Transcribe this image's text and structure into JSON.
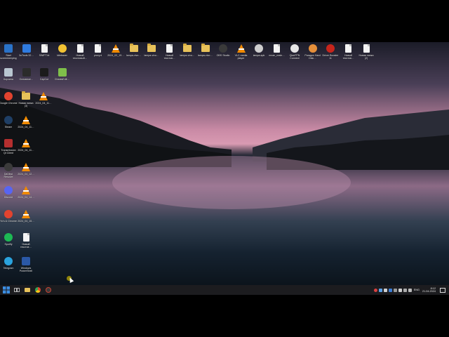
{
  "desktop": {
    "top_row": [
      {
        "label": "Start screenkeeping",
        "icon": "computer-icon",
        "kind": "square",
        "color": "#2a73c9"
      },
      {
        "label": "3uTools 32…",
        "icon": "3utools-icon",
        "kind": "square",
        "color": "#2f7be0"
      },
      {
        "label": "SWIFT.bt",
        "icon": "text-file-icon",
        "kind": "doc"
      },
      {
        "label": "Idlebacer",
        "icon": "emoji-icon",
        "kind": "circle",
        "color": "#f2c233"
      },
      {
        "label": "Новый текстовый…",
        "icon": "text-file-icon",
        "kind": "doc"
      },
      {
        "label": "proxy.d",
        "icon": "text-file-icon",
        "kind": "doc"
      },
      {
        "label": "2024_02_19…",
        "icon": "vlc-icon",
        "kind": "vlc"
      },
      {
        "label": "lampa-vivo…",
        "icon": "archive-icon",
        "kind": "folder"
      },
      {
        "label": "lampa-vivo…",
        "icon": "archive-icon",
        "kind": "folder"
      },
      {
        "label": "Новый текстов…",
        "icon": "text-file-icon",
        "kind": "doc"
      },
      {
        "label": "lampa-vivo…",
        "icon": "archive-icon",
        "kind": "folder"
      },
      {
        "label": "lampa-vivo…",
        "icon": "archive-icon",
        "kind": "folder"
      },
      {
        "label": "OBS Studio",
        "icon": "obs-icon",
        "kind": "circle",
        "color": "#3a3a3a"
      },
      {
        "label": "VLC media player",
        "icon": "vlc-icon",
        "kind": "vlc"
      },
      {
        "label": "lampa.apk",
        "icon": "apk-icon",
        "kind": "circle",
        "color": "#cfcfcf"
      },
      {
        "label": "mnan_reale…",
        "icon": "text-file-icon",
        "kind": "doc"
      },
      {
        "label": "QianFPN Connect",
        "icon": "vpn-icon",
        "kind": "circle",
        "color": "#e7e7e7"
      },
      {
        "label": "Paragon Hard Disk…",
        "icon": "paragon-icon",
        "kind": "circle",
        "color": "#e58f3a"
      },
      {
        "label": "Driver Booster 11",
        "icon": "driver-booster-icon",
        "kind": "circle",
        "color": "#c7251b"
      },
      {
        "label": "Новый текстов…",
        "icon": "text-file-icon",
        "kind": "doc"
      },
      {
        "label": "Новая папка (2)",
        "icon": "text-file-icon",
        "kind": "doc"
      }
    ],
    "second_row": [
      {
        "label": "Корзина",
        "icon": "recycle-bin-icon",
        "kind": "square",
        "color": "#b9c6d1"
      },
      {
        "label": "Основное…",
        "icon": "shortcut-icon",
        "kind": "square",
        "color": "#2b2b2b"
      },
      {
        "label": "CapCut",
        "icon": "capcut-icon",
        "kind": "square",
        "color": "#1b1b1b"
      },
      {
        "label": "CheatsEdit…",
        "icon": "cheats-icon",
        "kind": "square",
        "color": "#7fc04a"
      }
    ],
    "left_col_1": [
      {
        "label": "Google Chrome",
        "icon": "chrome-icon",
        "kind": "circle",
        "color": "#e2432f"
      },
      {
        "label": "Steam",
        "icon": "steam-icon",
        "kind": "circle",
        "color": "#1f3f66"
      },
      {
        "label": "Transmission Qt Client",
        "icon": "transmission-icon",
        "kind": "square",
        "color": "#b52f2f"
      },
      {
        "label": "DaVinci Resolve",
        "icon": "davinci-icon",
        "kind": "circle",
        "color": "#3b3b3b"
      },
      {
        "label": "Discord",
        "icon": "discord-icon",
        "kind": "circle",
        "color": "#5865f2"
      },
      {
        "label": "Yo's & Chrome",
        "icon": "chrome-icon",
        "kind": "circle",
        "color": "#e2432f"
      },
      {
        "label": "Spotify",
        "icon": "spotify-icon",
        "kind": "circle",
        "color": "#1db954"
      },
      {
        "label": "Telegram",
        "icon": "telegram-icon",
        "kind": "circle",
        "color": "#2aa3de"
      }
    ],
    "left_col_2": [
      {
        "label": "Новая папка (3)",
        "icon": "folder-icon",
        "kind": "folder"
      },
      {
        "label": "2024_04_11…",
        "icon": "vlc-icon",
        "kind": "vlc"
      },
      {
        "label": "2024_04_11…",
        "icon": "vlc-icon",
        "kind": "vlc"
      },
      {
        "label": "2024_04_12…",
        "icon": "vlc-icon",
        "kind": "vlc"
      },
      {
        "label": "2024_04_14…",
        "icon": "vlc-icon",
        "kind": "vlc"
      },
      {
        "label": "2024_04_15…",
        "icon": "vlc-icon",
        "kind": "vlc"
      },
      {
        "label": "Новый текстов…",
        "icon": "text-file-icon",
        "kind": "doc"
      },
      {
        "label": "Windows PowerShell",
        "icon": "powershell-icon",
        "kind": "square",
        "color": "#2a58a6"
      }
    ],
    "extra_col_3": [
      {
        "label": "2024_04_11…",
        "icon": "vlc-icon",
        "kind": "vlc"
      }
    ]
  },
  "taskbar": {
    "start_color": "#3b8de0",
    "pinned": [
      {
        "icon": "start-icon",
        "name": "start-button"
      },
      {
        "icon": "task-view-icon",
        "name": "task-view-button"
      },
      {
        "icon": "file-explorer-icon",
        "name": "explorer-button"
      },
      {
        "icon": "chrome-icon",
        "name": "chrome-button"
      },
      {
        "icon": "obs-icon",
        "name": "obs-button"
      }
    ],
    "tray": [
      "shield-icon",
      "network-icon",
      "volume-icon",
      "bluetooth-icon",
      "battery-icon",
      "speaker-icon",
      "usb-icon",
      "keyboard-icon"
    ],
    "language": "ENG",
    "time": "8:12",
    "date": "21.04.2024"
  }
}
